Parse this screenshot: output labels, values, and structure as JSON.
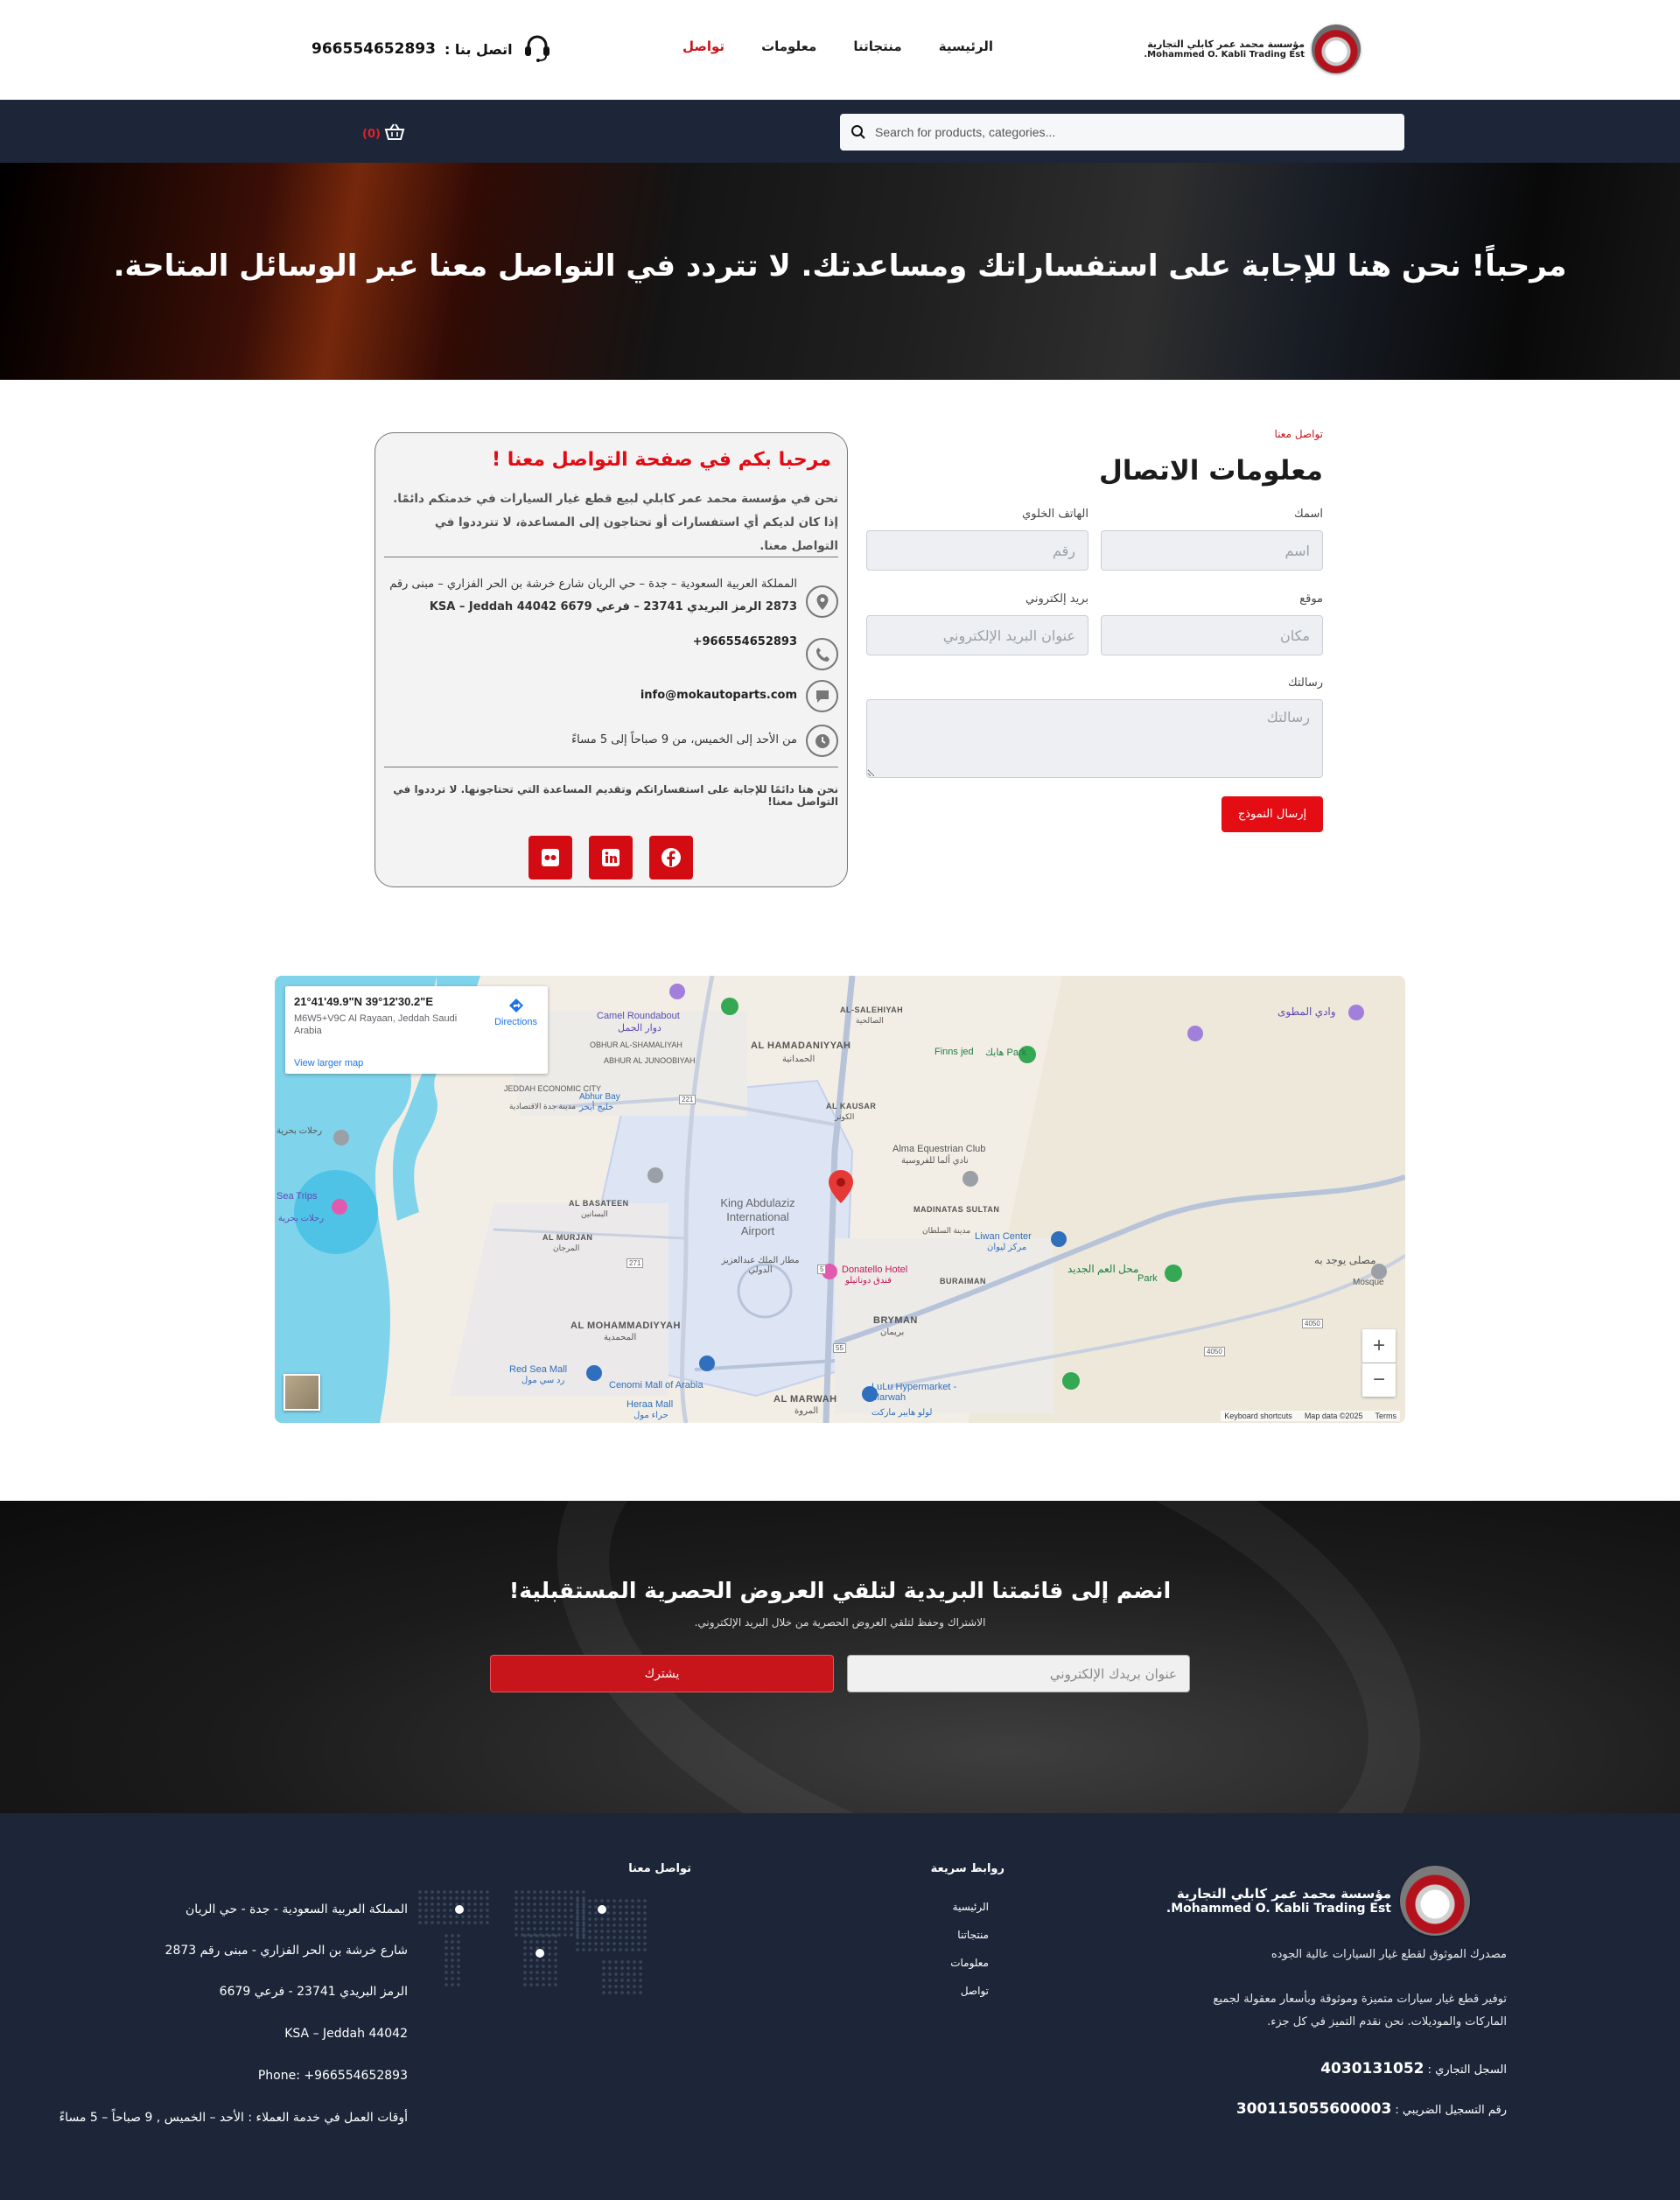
{
  "header": {
    "logo_ar": "مؤسسة محمد عمر كابلي التجارية",
    "logo_en": "Mohammed O. Kabli Trading Est.",
    "nav": [
      {
        "label": "الرئيسية",
        "active": false
      },
      {
        "label": "منتجاتنا",
        "active": false
      },
      {
        "label": "معلومات",
        "active": false
      },
      {
        "label": "تواصل",
        "active": true
      }
    ],
    "call_label": "اتصل بنا :",
    "phone": "966554652893"
  },
  "search": {
    "placeholder": "Search for products, categories...",
    "cart_count": "(0)"
  },
  "hero": {
    "title": "مرحباً! نحن هنا للإجابة على استفساراتك ومساعدتك. لا تتردد في التواصل معنا عبر الوسائل المتاحة."
  },
  "form": {
    "breadcrumb": "تواصل معنا",
    "title": "معلومات الاتصال",
    "name_label": "اسمك",
    "name_placeholder": "اسم",
    "phone_label": "الهاتف الخلوي",
    "phone_placeholder": "رقم",
    "location_label": "موقع",
    "location_placeholder": "مكان",
    "email_label": "بريد إلكتروني",
    "email_placeholder": "عنوان البريد الإلكتروني",
    "message_label": "رسالتك",
    "message_placeholder": "رسالتك",
    "submit_label": "إرسال النموذج"
  },
  "info_card": {
    "title": "مرحبا بكم في صفحة التواصل معنا !",
    "intro": "نحن في مؤسسة محمد عمر كابلي لبيع قطع غيار السيارات في خدمتكم دائمًا. إذا كان لديكم أي استفسارات أو تحتاجون إلى المساعدة، لا تترددوا في التواصل معنا.",
    "address_line1": "المملكة العربية السعودية – جدة – حي الريان شارع خرشة بن الحر الفزاري – مبنى رقم",
    "address_line2": "2873 الرمز البريدي 23741 – فرعي 6679 KSA – Jeddah 44042",
    "phone": "+966554652893",
    "email": "info@mokautoparts.com",
    "hours": "من الأحد إلى الخميس، من 9 صباحاً إلى 5 مساءً",
    "outro": "نحن هنا دائمًا للإجابة على استفساراتكم وتقديم المساعدة التي تحتاجونها. لا ترددوا في التواصل معنا!",
    "socials": [
      "facebook-icon",
      "linkedin-icon",
      "flickr-icon"
    ]
  },
  "map": {
    "coords": "21°41'49.9\"N 39°12'30.2\"E",
    "address": "M6W5+V9C Al Rayaan, Jeddah Saudi Arabia",
    "directions": "Directions",
    "larger_map": "View larger map",
    "zoom_in": "+",
    "zoom_out": "−",
    "footer": [
      "Keyboard shortcuts",
      "Map data ©2025",
      "Terms"
    ],
    "labels": {
      "camel": "Camel Roundabout",
      "camel_ar": "دوار الجمل",
      "obhur": "OBHUR AL-SHAMALIYAH",
      "obhur_ar": "أبحر الشمالية",
      "ahbur_j": "ABHUR AL JUNOOBIYAH",
      "ahbur_j_ar": "أبحر الجنوبية",
      "jeddah_city": "JEDDAH ECONOMIC CITY",
      "jeddah_city_ar": "مدينة جدة الاقتصادية",
      "abhur_bay": "Abhur Bay",
      "abhur_bay_ar": "خليج أبحر",
      "hamadaniyah": "AL HAMADANIYYAH",
      "hamadaniyah_ar": "الحمدانية",
      "salehiyah": "AL-SALEHIYAH",
      "salehiyah_ar": "الصالحية",
      "wadi": "وادي المطوى",
      "finns": "Finns jed",
      "finns_ar": "هايك Park",
      "kausar": "AL KAUSAR",
      "kausar_ar": "الكوثر",
      "alma": "Alma Equestrian Club",
      "alma_ar": "نادي ألما للفروسية",
      "king": "King Abdulaziz International Airport",
      "king_ar": "مطار الملك عبدالعزيز الدولي",
      "basateen": "AL BASATEEN",
      "basateen_ar": "البساتين",
      "murjan": "AL MURJAN",
      "murjan_ar": "المرجان",
      "sea_trips": "Sea Trips",
      "sea_trips_ar": "رحلات بحرية",
      "jazeera": "رحلات بحرية",
      "madinat": "MADINATAS SULTAN",
      "madinat_ar": "مدينة السلطان",
      "liwan": "Liwan Center",
      "liwan_ar": "مركز ليوان",
      "donatello": "Donatello Hotel",
      "donatello_ar": "فندق دوناتيلو",
      "buraiman": "BURAIMAN",
      "mahal": "محل العم الجديد",
      "mahal_park": "Park",
      "mosque": "مصلى يوجد به",
      "mosque_en": "Mosque",
      "mohammadiyyah": "AL MOHAMMADIYYAH",
      "mohammadiyyah_ar": "المحمدية",
      "bryman": "BRYMAN",
      "bryman_ar": "بريمان",
      "red_sea": "Red Sea Mall",
      "red_sea_ar": "رد سي مول",
      "cenomi": "Cenomi Mall of Arabia",
      "heraa": "Heraa Mall",
      "heraa_ar": "حراء مول",
      "marwah": "AL MARWAH",
      "marwah_ar": "المروة",
      "lulu": "LuLu Hypermarket - Marwah",
      "lulu_ar": "لولو هايبر ماركت",
      "r4050a": "4050",
      "r4050b": "4050",
      "r221": "221",
      "r271": "271",
      "r55": "55",
      "r5": "5"
    }
  },
  "newsletter": {
    "title": "انضم إلى قائمتنا البريدية لتلقي العروض الحصرية المستقبلية!",
    "subtitle": "الاشتراك وحفظ لتلقي العروض الحصرية من خلال البريد الإلكتروني.",
    "email_placeholder": "عنوان بريدك الإلكتروني",
    "button": "يشترك"
  },
  "footer": {
    "logo_ar": "مؤسسة محمد عمر كابلي التجارية",
    "logo_en": "Mohammed O. Kabli Trading Est.",
    "tagline": "مصدرك الموثوق لقطع غيار السيارات عالية الجوده",
    "description": "توفير قطع غيار سيارات متميزة وموثوقة وبأسعار معقولة لجميع الماركات والموديلات. نحن نقدم التميز في كل جزء.",
    "reg_label": "السجل التجاري :",
    "reg_value": "4030131052",
    "vat_label": "رقم التسجيل الضريبي :",
    "vat_value": "300115055600003",
    "links_title": "روابط سريعة",
    "links": [
      "الرئيسية",
      "منتجاتنا",
      "معلومات",
      "تواصل"
    ],
    "contact_title": "تواصل معنا",
    "contact_lines": [
      "المملكة العربية السعودية - جدة - حي الريان",
      "شارع خرشة بن الحر الفزاري - مبنى رقم 2873",
      "الرمز البريدي 23741 - فرعي 6679",
      "KSA – Jeddah 44042",
      "Phone: +966554652893",
      "أوقات العمل في خدمة العملاء : الأحد – الخميس , 9 صباحاً – 5 مساءً"
    ]
  },
  "colors": {
    "accent_red": "#c8151b",
    "button_red": "#e40d14",
    "navy": "#1c2638"
  }
}
